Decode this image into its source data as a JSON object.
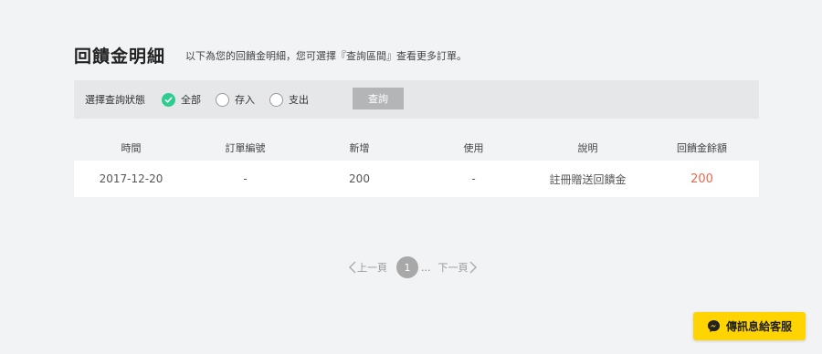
{
  "header": {
    "title": "回饋金明細",
    "subtitle": "以下為您的回饋金明細，您可選擇『查詢區間』查看更多訂單。"
  },
  "filter": {
    "label": "選擇查詢狀態",
    "options": [
      {
        "label": "全部",
        "checked": true
      },
      {
        "label": "存入",
        "checked": false
      },
      {
        "label": "支出",
        "checked": false
      }
    ],
    "query_button": "查詢"
  },
  "table": {
    "columns": [
      "時間",
      "訂單編號",
      "新增",
      "使用",
      "說明",
      "回饋金餘額"
    ],
    "rows": [
      {
        "time": "2017-12-20",
        "order_no": "-",
        "added": "200",
        "used": "-",
        "description": "註冊贈送回饋金",
        "balance": "200"
      }
    ]
  },
  "pagination": {
    "prev": "上一頁",
    "current": "1",
    "ellipsis": "...",
    "next": "下一頁"
  },
  "chat": {
    "label": "傳訊息給客服",
    "icon": "messenger-icon"
  },
  "colors": {
    "accent_green": "#2ecc8e",
    "balance_red": "#e86a4a",
    "chat_yellow": "#ffd400"
  }
}
